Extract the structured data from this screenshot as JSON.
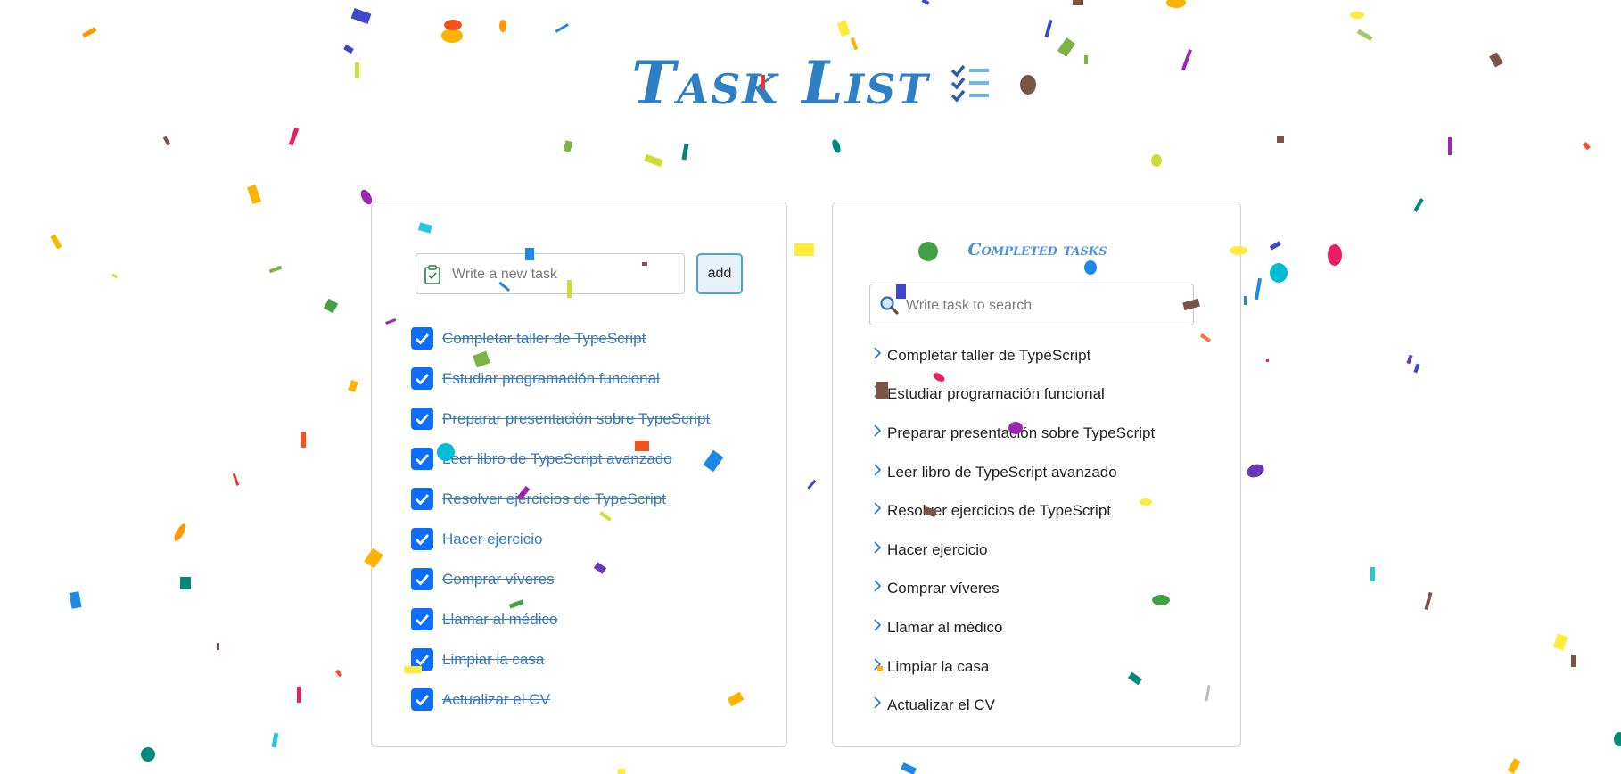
{
  "header": {
    "title": "Task List",
    "icon": "checklist-icon"
  },
  "new_task": {
    "placeholder": "Write a new task",
    "value": "",
    "icon": "clipboard-check-icon",
    "add_label": "add"
  },
  "tasks": [
    {
      "label": "Completar taller de TypeScript",
      "checked": true
    },
    {
      "label": "Estudiar programación funcional",
      "checked": true
    },
    {
      "label": "Preparar presentación sobre TypeScript",
      "checked": true
    },
    {
      "label": "Leer libro de TypeScript avanzado",
      "checked": true
    },
    {
      "label": "Resolver ejercicios de TypeScript",
      "checked": true
    },
    {
      "label": "Hacer ejercicio",
      "checked": true
    },
    {
      "label": "Comprar víveres",
      "checked": true
    },
    {
      "label": "Llamar al médico",
      "checked": true
    },
    {
      "label": "Limpiar la casa",
      "checked": true
    },
    {
      "label": "Actualizar el CV",
      "checked": true
    }
  ],
  "completed": {
    "title": "Completed tasks",
    "search_placeholder": "Write task to search",
    "search_value": "",
    "search_icon": "search-icon",
    "items": [
      "Completar taller de TypeScript",
      "Estudiar programación funcional",
      "Preparar presentación sobre TypeScript",
      "Leer libro de TypeScript avanzado",
      "Resolver ejercicios de TypeScript",
      "Hacer ejercicio",
      "Comprar víveres",
      "Llamar al médico",
      "Limpiar la casa",
      "Actualizar el CV"
    ]
  },
  "colors": {
    "title": "#2f7fc4",
    "checkbox": "#0d6efd",
    "task_text": "#3a7ab8",
    "completed_title": "#4a90d6",
    "add_button_border": "#4ba3e0"
  }
}
